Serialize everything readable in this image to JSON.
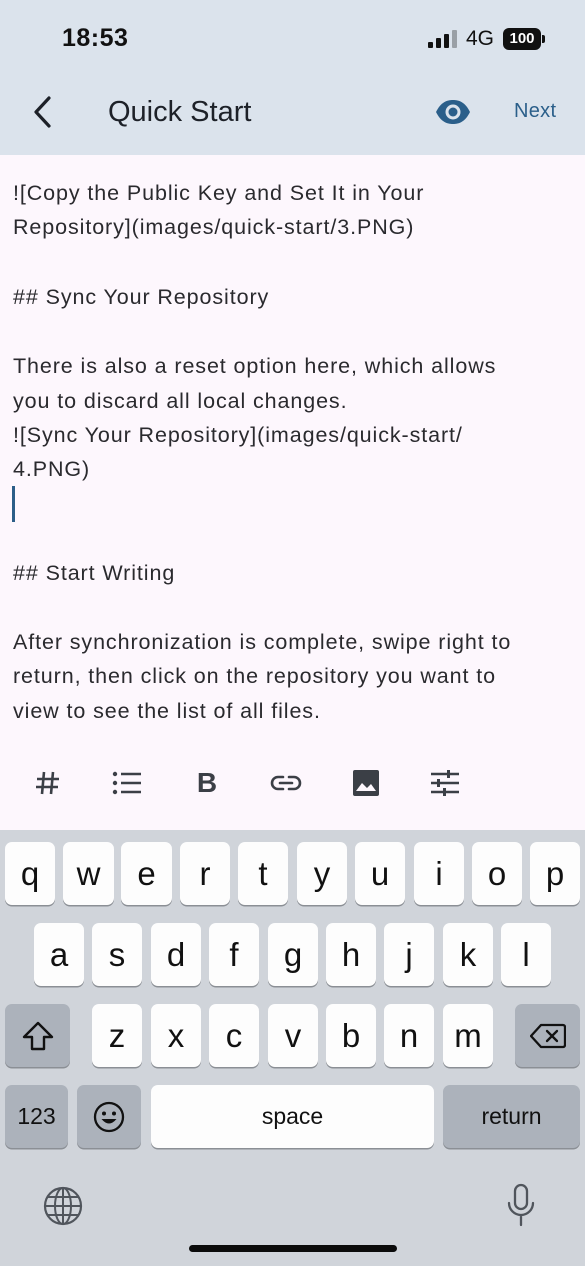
{
  "status_bar": {
    "time": "18:53",
    "network": "4G",
    "battery": "100"
  },
  "app_bar": {
    "title": "Quick Start",
    "next_label": "Next"
  },
  "editor": {
    "lines": [
      "![Copy the Public Key and Set It in Your",
      "Repository](images/quick-start/3.PNG)",
      "## Sync Your Repository",
      "There is also a reset option here, which allows",
      "you to discard all local changes.",
      "![Sync Your Repository](images/quick-start/",
      "4.PNG)",
      "## Start Writing",
      "After synchronization is complete, swipe right to",
      "return, then click on the repository you want to",
      "view to see the list of all files."
    ]
  },
  "toolbar": {
    "tools": [
      "hash-icon",
      "list-icon",
      "bold-icon",
      "link-icon",
      "image-icon",
      "settings-sliders-icon"
    ],
    "bold_label": "B"
  },
  "keyboard": {
    "row1": [
      "q",
      "w",
      "e",
      "r",
      "t",
      "y",
      "u",
      "i",
      "o",
      "p"
    ],
    "row2": [
      "a",
      "s",
      "d",
      "f",
      "g",
      "h",
      "j",
      "k",
      "l"
    ],
    "row3": [
      "z",
      "x",
      "c",
      "v",
      "b",
      "n",
      "m"
    ],
    "numbers_label": "123",
    "space_label": "space",
    "return_label": "return"
  },
  "colors": {
    "header_bg": "#dbe3ec",
    "editor_bg": "#fdf7fd",
    "accent": "#2b5f8a",
    "keyboard_bg": "#d0d4da"
  }
}
